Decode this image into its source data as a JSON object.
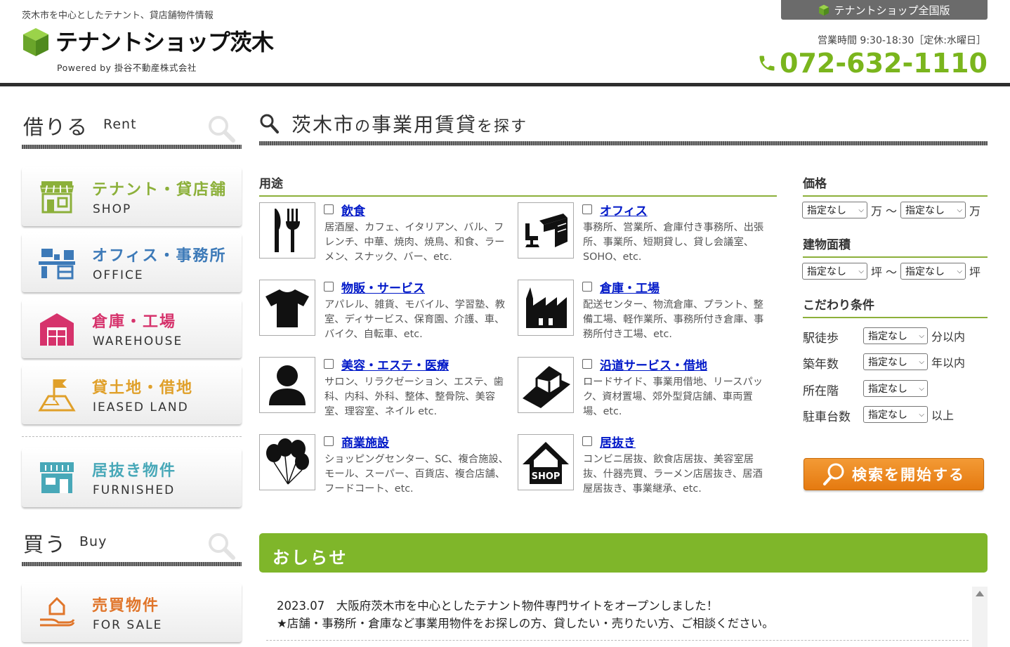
{
  "header": {
    "tagline": "茨木市を中心としたテナント、貸店舗物件情報",
    "logo_title": "テナントショップ茨木",
    "logo_powered": "Powered by 掛谷不動産株式会社",
    "national_label": "テナントショップ全国版",
    "hours": "営業時間 9:30-18:30［定休:水曜日］",
    "phone": "072-632-1110"
  },
  "sidebar": {
    "rent_heading": "借りる",
    "rent_heading_en": "Rent",
    "rent_items": [
      {
        "label": "テナント・貸店舗",
        "sub": "SHOP",
        "color": "#8cb03a",
        "icon": "shop-icon"
      },
      {
        "label": "オフィス・事務所",
        "sub": "OFFICE",
        "color": "#3d7ab8",
        "icon": "office-icon"
      },
      {
        "label": "倉庫・工場",
        "sub": "WAREHOUSE",
        "color": "#d6336c",
        "icon": "warehouse-icon"
      },
      {
        "label": "貸土地・借地",
        "sub": "IEASED LAND",
        "color": "#e0a02a",
        "icon": "land-flag-icon"
      }
    ],
    "furnished_item": {
      "label": "居抜き物件",
      "sub": "FURNISHED",
      "color": "#48a8b8",
      "icon": "storefront-icon"
    },
    "buy_heading": "買う",
    "buy_heading_en": "Buy",
    "buy_items": [
      {
        "label": "売買物件",
        "sub": "FOR SALE",
        "color": "#e0752a",
        "icon": "hand-house-icon"
      }
    ]
  },
  "search": {
    "title_city": "茨木市",
    "title_no": "の",
    "title_main": "事業用賃貸",
    "title_suffix": "を探す",
    "usage_heading": "用途",
    "usages": [
      {
        "name": "飲食",
        "desc": "居酒屋、カフェ、イタリアン、バル、フレンチ、中華、焼肉、焼鳥、和食、ラーメン、スナック、バー、etc.",
        "icon": "fork-knife-icon"
      },
      {
        "name": "オフィス",
        "desc": "事務所、営業所、倉庫付き事務所、出張所、事業所、短期貸し、貸し会議室、SOHO、etc.",
        "icon": "desk-chair-icon"
      },
      {
        "name": "物販・サービス",
        "desc": "アパレル、雑貨、モバイル、学習塾、教室、ディサービス、保育園、介護、車、バイク、自転車、etc.",
        "icon": "tshirt-icon"
      },
      {
        "name": "倉庫・工場",
        "desc": "配送センター、物流倉庫、プラント、整備工場、軽作業所、事務所付き倉庫、事務所付き工場、etc.",
        "icon": "factory-icon"
      },
      {
        "name": "美容・エステ・医療",
        "desc": "サロン、リラクゼーション、エステ、歯科、内科、外科、整体、整骨院、美容室、理容室、ネイル etc.",
        "icon": "person-icon"
      },
      {
        "name": "沿道サービス・借地",
        "desc": "ロードサイド、事業用借地、リースパック、資材置場、郊外型貸店舗、車両置場、etc.",
        "icon": "roadside-house-icon"
      },
      {
        "name": "商業施設",
        "desc": "ショッピングセンター、SC、複合施設、モール、スーパー、百貨店、複合店舗、フードコート、etc.",
        "icon": "balloons-icon"
      },
      {
        "name": "居抜き",
        "desc": "コンビニ居抜、飲食店居抜、美容室居抜、什器売買、ラーメン店居抜き、居酒屋居抜き、事業継承、etc.",
        "icon": "shop-house-icon"
      }
    ],
    "shop_badge": "SHOP",
    "price_heading": "価格",
    "area_heading": "建物面積",
    "cond_heading": "こだわり条件",
    "unspecified": "指定なし",
    "man": "万",
    "tilde": "〜",
    "tsubo": "坪",
    "conditions": [
      {
        "label": "駅徒歩",
        "unit": "分以内"
      },
      {
        "label": "築年数",
        "unit": "年以内"
      },
      {
        "label": "所在階",
        "unit": ""
      },
      {
        "label": "駐車台数",
        "unit": "以上"
      }
    ],
    "search_button": "検索を開始する"
  },
  "news": {
    "heading": "おしらせ",
    "line1": "2023.07　大阪府茨木市を中心としたテナント物件専門サイトをオープンしました！",
    "line2": "★店舗・事務所・倉庫など事業用物件をお探しの方、貸したい・売りたい方、ご相談ください。"
  },
  "colors": {
    "accent_green": "#7fb62a",
    "phone_green": "#7ab51d",
    "search_orange": "#f08c22",
    "link_blue": "#0018c8"
  }
}
